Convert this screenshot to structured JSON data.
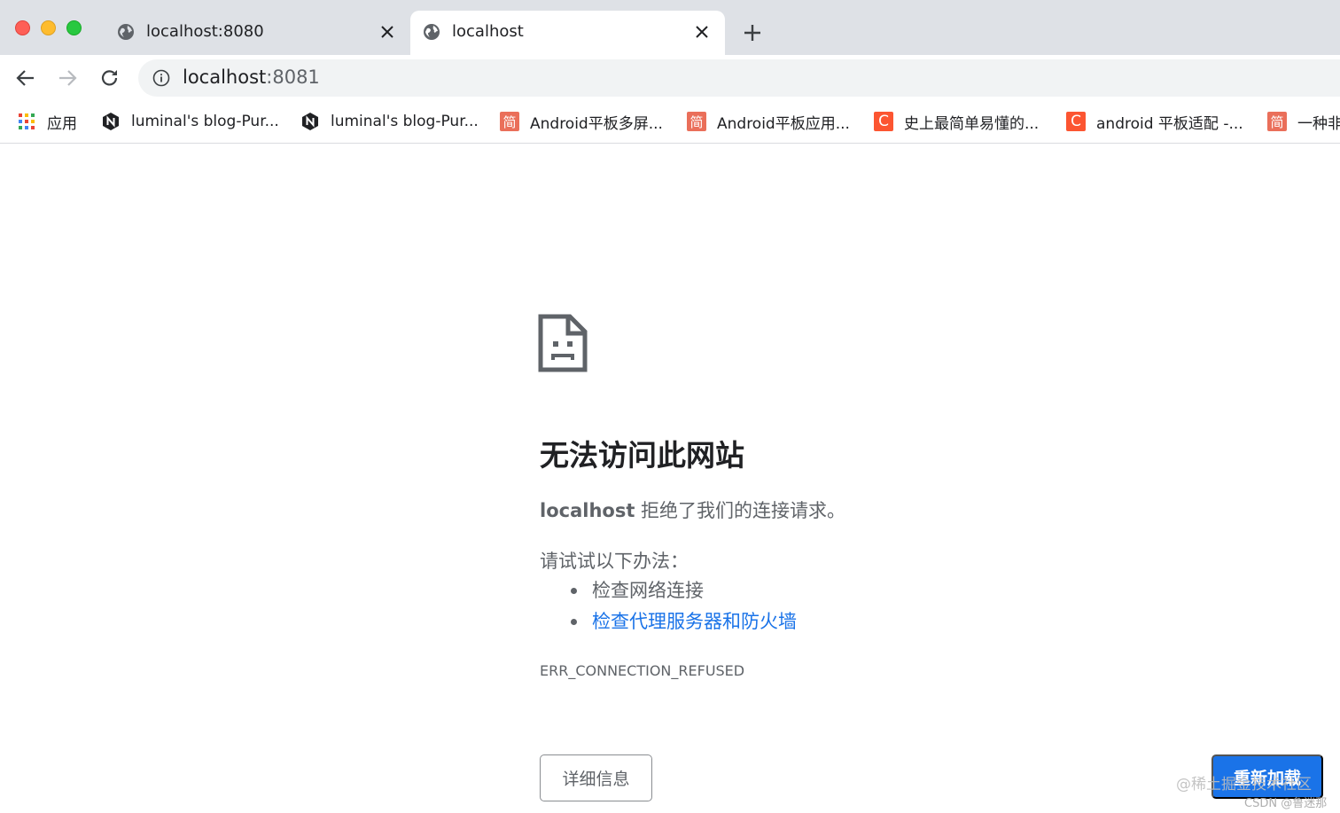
{
  "browser": {
    "tabs": [
      {
        "title": "localhost:8080",
        "active": false
      },
      {
        "title": "localhost",
        "active": true
      }
    ],
    "new_tab_glyph": "+",
    "address": {
      "host": "localhost",
      "port": ":8081"
    },
    "bookmarks": [
      {
        "label": "应用",
        "icon": "apps-grid-icon"
      },
      {
        "label": "luminal's blog-Pur...",
        "icon": "n-logo-icon"
      },
      {
        "label": "luminal's blog-Pur...",
        "icon": "n-logo-icon"
      },
      {
        "label": "Android平板多屏...",
        "icon": "jianshu-icon",
        "icon_text": "简"
      },
      {
        "label": "Android平板应用...",
        "icon": "jianshu-icon",
        "icon_text": "简"
      },
      {
        "label": "史上最简单易懂的...",
        "icon": "csdn-icon",
        "icon_text": "C"
      },
      {
        "label": "android 平板适配 -...",
        "icon": "csdn-icon",
        "icon_text": "C"
      },
      {
        "label": "一种非",
        "icon": "jianshu-icon",
        "icon_text": "简"
      }
    ]
  },
  "error_page": {
    "heading": "无法访问此网站",
    "host": "localhost",
    "description_suffix": " 拒绝了我们的连接请求。",
    "suggestions_title": "请试试以下办法：",
    "suggestions": [
      {
        "text": "检查网络连接",
        "link": false
      },
      {
        "text": "检查代理服务器和防火墙",
        "link": true
      }
    ],
    "error_code": "ERR_CONNECTION_REFUSED",
    "details_button": "详细信息",
    "reload_button": "重新加载"
  },
  "watermark": {
    "line1": "@稀土掘金技术社区",
    "line2": "CSDN @鲁迷那"
  },
  "colors": {
    "tabstrip": "#dee1e6",
    "link": "#1a73e8",
    "primary_button": "#1a73e8",
    "secondary_text": "#5f6368"
  }
}
